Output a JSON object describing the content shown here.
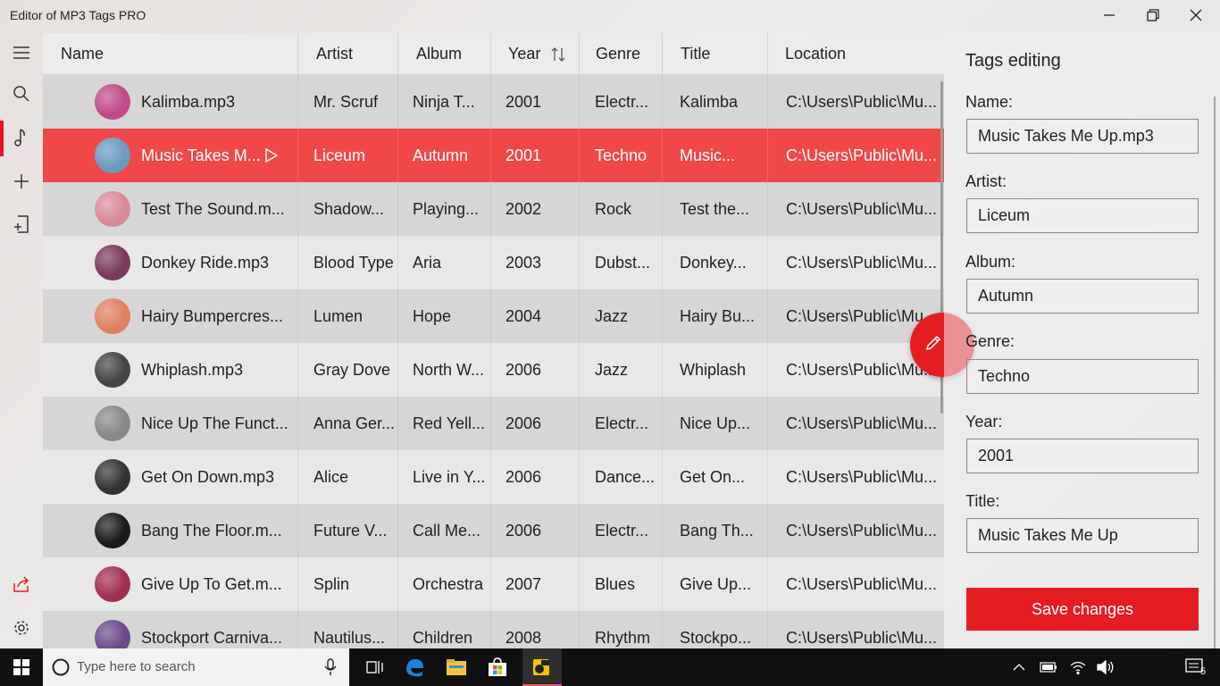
{
  "window": {
    "title": "Editor of MP3 Tags PRO"
  },
  "table": {
    "columns": [
      {
        "label": "Name"
      },
      {
        "label": "Artist"
      },
      {
        "label": "Album"
      },
      {
        "label": "Year",
        "sorted": true
      },
      {
        "label": "Genre"
      },
      {
        "label": "Title"
      },
      {
        "label": "Location"
      }
    ],
    "rows": [
      {
        "name": "Kalimba.mp3",
        "artist": "Mr. Scruf",
        "album": "Ninja T...",
        "year": "2001",
        "genre": "Electr...",
        "title": "Kalimba",
        "location": "C:\\Users\\Public\\Mu...",
        "art_color": "#c04a8a"
      },
      {
        "name": "Music Takes M...",
        "artist": "Liceum",
        "album": "Autumn",
        "year": "2001",
        "genre": "Techno",
        "title": "Music...",
        "location": "C:\\Users\\Public\\Mu...",
        "art_color": "#6a9bc0",
        "selected": true
      },
      {
        "name": "Test The Sound.m...",
        "artist": "Shadow...",
        "album": "Playing...",
        "year": "2002",
        "genre": "Rock",
        "title": "Test the...",
        "location": "C:\\Users\\Public\\Mu...",
        "art_color": "#d98a9a"
      },
      {
        "name": "Donkey Ride.mp3",
        "artist": "Blood Type",
        "album": "Aria",
        "year": "2003",
        "genre": "Dubst...",
        "title": "Donkey...",
        "location": "C:\\Users\\Public\\Mu...",
        "art_color": "#7a3a5a"
      },
      {
        "name": "Hairy Bumpercres...",
        "artist": "Lumen",
        "album": "Hope",
        "year": "2004",
        "genre": "Jazz",
        "title": "Hairy Bu...",
        "location": "C:\\Users\\Public\\Mu...",
        "art_color": "#e08060"
      },
      {
        "name": "Whiplash.mp3",
        "artist": "Gray Dove",
        "album": "North W...",
        "year": "2006",
        "genre": "Jazz",
        "title": "Whiplash",
        "location": "C:\\Users\\Public\\Mu...",
        "art_color": "#444444"
      },
      {
        "name": "Nice Up The Funct...",
        "artist": "Anna Ger...",
        "album": "Red Yell...",
        "year": "2006",
        "genre": "Electr...",
        "title": "Nice Up...",
        "location": "C:\\Users\\Public\\Mu...",
        "art_color": "#888888"
      },
      {
        "name": "Get On Down.mp3",
        "artist": "Alice",
        "album": "Live in Y...",
        "year": "2006",
        "genre": "Dance...",
        "title": "Get On...",
        "location": "C:\\Users\\Public\\Mu...",
        "art_color": "#333333"
      },
      {
        "name": "Bang The Floor.m...",
        "artist": "Future V...",
        "album": "Call Me...",
        "year": "2006",
        "genre": "Electr...",
        "title": "Bang Th...",
        "location": "C:\\Users\\Public\\Mu...",
        "art_color": "#1a1a1a"
      },
      {
        "name": "Give Up To Get.m...",
        "artist": "Splin",
        "album": "Orchestra",
        "year": "2007",
        "genre": "Blues",
        "title": "Give Up...",
        "location": "C:\\Users\\Public\\Mu...",
        "art_color": "#a03050"
      },
      {
        "name": "Stockport Carniva...",
        "artist": "Nautilus...",
        "album": "Children",
        "year": "2008",
        "genre": "Rhythm",
        "title": "Stockpo...",
        "location": "C:\\Users\\Public\\Mu...",
        "art_color": "#6a4a8a"
      }
    ]
  },
  "panel": {
    "title": "Tags editing",
    "fields": [
      {
        "label": "Name:",
        "value": "Music Takes Me Up.mp3"
      },
      {
        "label": "Artist:",
        "value": "Liceum"
      },
      {
        "label": "Album:",
        "value": "Autumn"
      },
      {
        "label": "Genre:",
        "value": "Techno"
      },
      {
        "label": "Year:",
        "value": "2001"
      },
      {
        "label": "Title:",
        "value": "Music Takes Me Up"
      }
    ],
    "save_label": "Save changes"
  },
  "taskbar": {
    "search_placeholder": "Type here to search",
    "notification_count": "5"
  },
  "colors": {
    "accent": "#e51d23",
    "selected_row": "#f04848"
  }
}
